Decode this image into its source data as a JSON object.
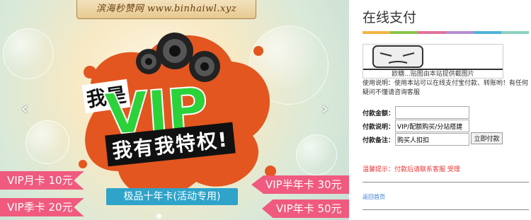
{
  "banner": {
    "site_ribbon": "滨海秒赞网 www.binhaiwl.xyz",
    "line1": "我是",
    "line2": "VIP",
    "line3": "我有我特权!",
    "prices_left": [
      "VIP月卡 10元",
      "VIP季卡 20元"
    ],
    "prices_right": [
      "VIP半年卡 30元",
      "VIP年卡 50元"
    ],
    "ten_year": "极品十年卡(活动专用)",
    "left_arrow": "‹",
    "right_arrow": "›"
  },
  "panel": {
    "title": "在线支付",
    "strip_colors": [
      "#f2b544",
      "#8ac44a",
      "#e0739a",
      "#b48ed1",
      "#4fb3d8",
      "#8ad0c0"
    ],
    "qr_caption": "欧糖...贴图由本站提供截图片",
    "usage_text": "使用说明：使用本站可以在线支付宝付款、转账哟！有任何疑问不懂请咨询客服",
    "form": {
      "amount_label": "付款金额：",
      "amount_value": "",
      "desc_label": "付款说明：",
      "desc_value": "VIP/配额购买/分站搭建",
      "note_label": "付款备注：",
      "note_value": "购买人扣扣",
      "pay_button": "立即付款"
    },
    "hint": "温馨提示：付款后请联系客服 受理",
    "back_link": "返回首页"
  }
}
